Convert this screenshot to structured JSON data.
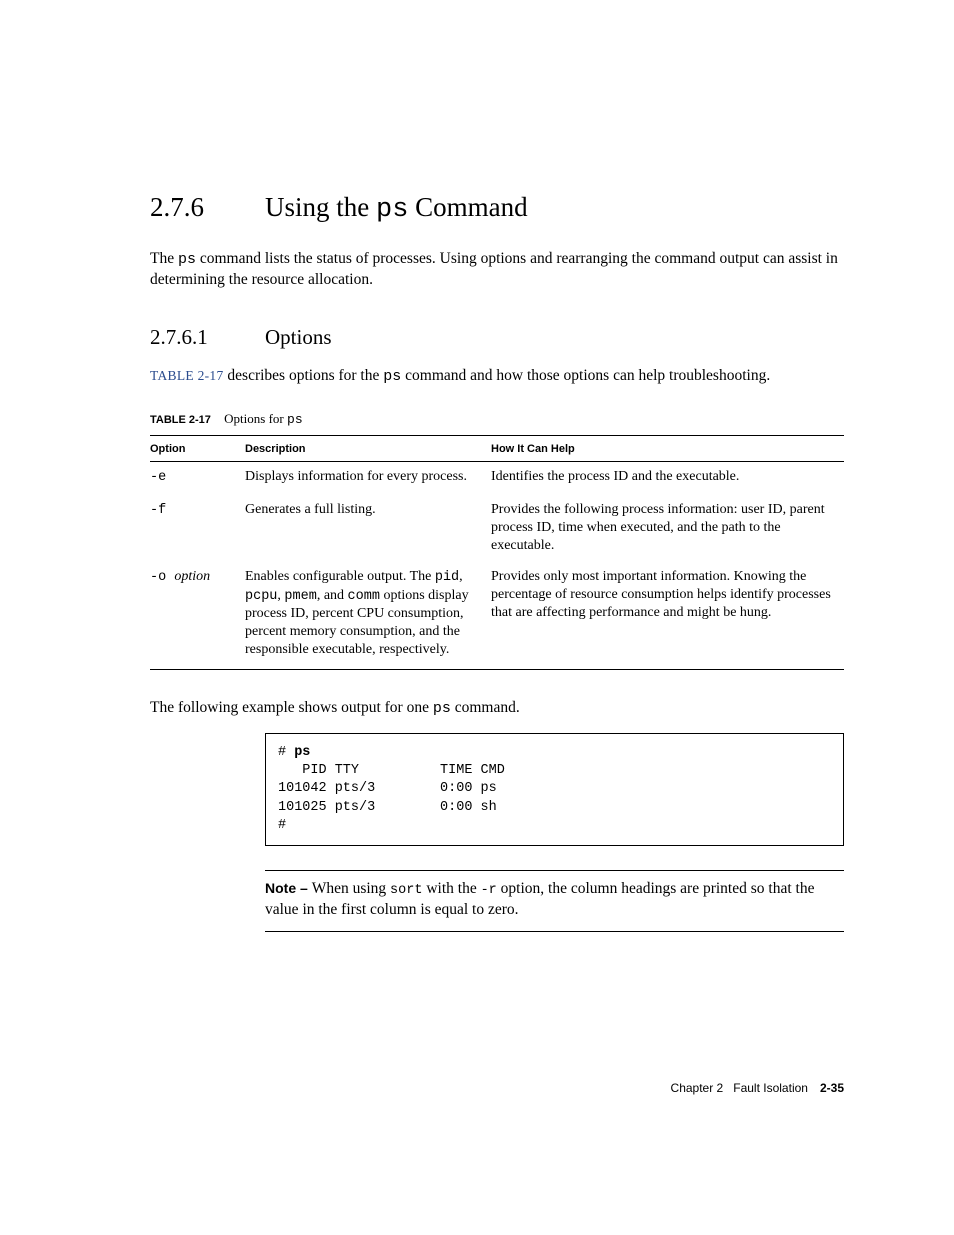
{
  "section": {
    "num": "2.7.6",
    "title_pre": "Using the ",
    "title_code": "ps",
    "title_post": " Command",
    "intro_pre": "The ",
    "intro_code": "ps",
    "intro_post": " command lists the status of processes. Using options and rearranging the command output can assist in determining the resource allocation."
  },
  "subsection": {
    "num": "2.7.6.1",
    "title": "Options",
    "xref": "TABLE 2-17",
    "para_mid": " describes options for the ",
    "para_code": "ps",
    "para_post": " command and how those options can help troubleshooting."
  },
  "table": {
    "caption_tag": "TABLE 2-17",
    "caption_pre": "Options for ",
    "caption_code": "ps",
    "headers": {
      "c1": "Option",
      "c2": "Description",
      "c3": "How It Can Help"
    },
    "rows": [
      {
        "opt": "-e",
        "desc": "Displays information for every process.",
        "help": "Identifies the process ID and the executable."
      },
      {
        "opt": "-f",
        "desc": "Generates a full listing.",
        "help": "Provides the following process information: user ID, parent process ID, time when executed, and the path to the executable."
      },
      {
        "opt_pre": "-o ",
        "opt_ital": "option",
        "desc_pre": "Enables configurable output. The ",
        "desc_code1": "pid",
        "desc_mid1": ", ",
        "desc_code2": "pcpu",
        "desc_mid2": ", ",
        "desc_code3": "pmem",
        "desc_mid3": ", and ",
        "desc_code4": "comm",
        "desc_post": " options display process ID, percent CPU consumption, percent memory consumption, and the responsible executable, respectively.",
        "help": "Provides only most important information. Knowing the percentage of resource consumption helps identify processes that are affecting performance and might be hung."
      }
    ]
  },
  "example": {
    "intro_pre": "The following example shows output for one ",
    "intro_code": "ps",
    "intro_post": "  command.",
    "prompt1": "# ",
    "cmd": "ps",
    "out1": "   PID TTY          TIME CMD",
    "out2": "101042 pts/3        0:00 ps",
    "out3": "101025 pts/3        0:00 sh",
    "prompt2": "#"
  },
  "note": {
    "lead": "Note – ",
    "pre": "When using ",
    "code1": "sort",
    "mid": " with the ",
    "code2": "-r",
    "post": " option, the column headings are printed so that the value in the first column is equal to zero."
  },
  "footer": {
    "chapter": "Chapter 2",
    "title": "Fault Isolation",
    "page": "2-35"
  }
}
